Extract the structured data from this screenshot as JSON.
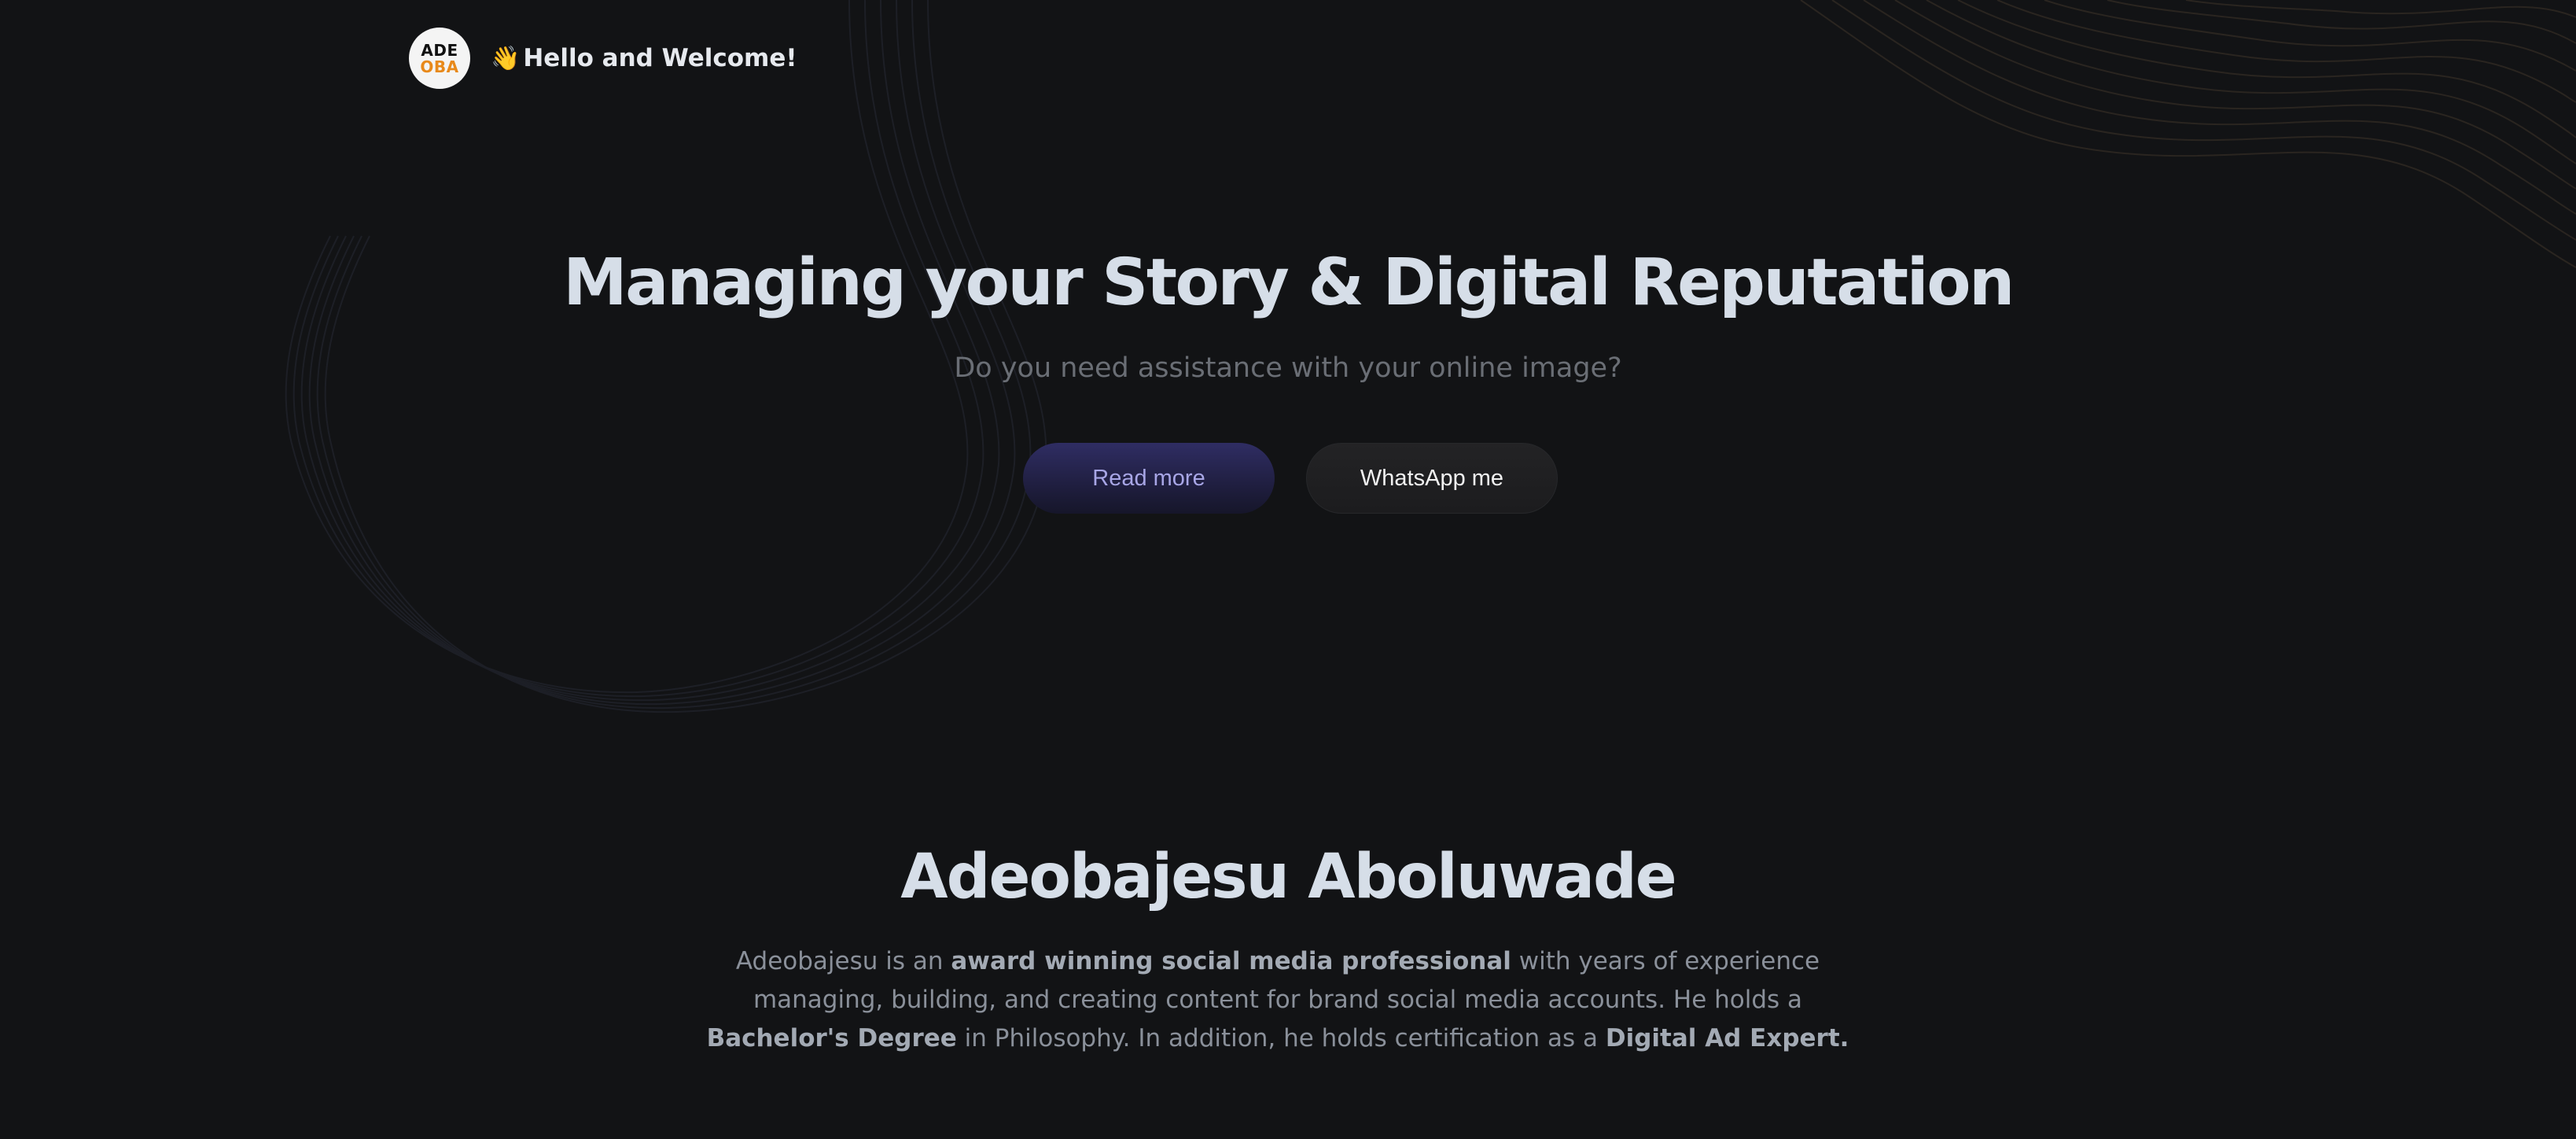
{
  "header": {
    "logo": {
      "line1": "ADE",
      "line2": "OBA",
      "accent_color": "#e8891a"
    },
    "greeting_emoji": "👋",
    "greeting_text": "Hello and Welcome!"
  },
  "hero": {
    "title": "Managing your Story & Digital Reputation",
    "subtitle": "Do you need assistance with your online image?",
    "primary_button": "Read more",
    "secondary_button": "WhatsApp me"
  },
  "about": {
    "name": "Adeobajesu Aboluwade",
    "bio": {
      "part1": "Adeobajesu is an ",
      "bold1": "award winning social media professional",
      "part2": " with years of experience managing, building, and creating content for brand social media accounts. He holds a ",
      "bold2": "Bachelor's Degree",
      "part3": " in Philosophy. In addition, he holds certification as a ",
      "bold3": "Digital Ad Expert."
    }
  },
  "colors": {
    "background": "#121315",
    "heading": "#d6dee8",
    "muted_text": "#6a6e75",
    "primary_button_text": "#a8a6e6"
  }
}
